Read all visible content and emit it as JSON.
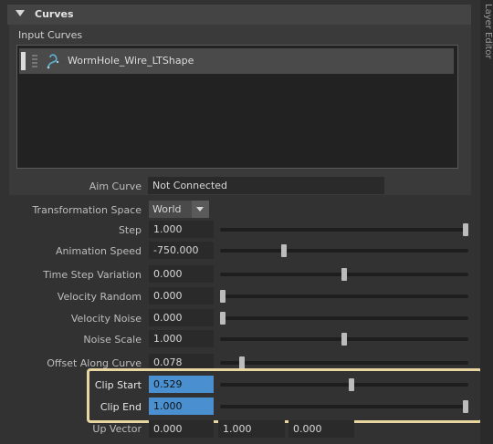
{
  "section": {
    "title": "Curves"
  },
  "input_curves": {
    "label": "Input Curves",
    "items": [
      {
        "name": "WormHole_Wire_LTShape"
      }
    ]
  },
  "aim_curve": {
    "label": "Aim Curve",
    "value": "Not Connected"
  },
  "transformation_space": {
    "label": "Transformation Space",
    "value": "World"
  },
  "params": [
    {
      "label": "Step",
      "value": "1.000",
      "slider": 1.0
    },
    {
      "label": "Animation Speed",
      "value": "-750.000",
      "slider": 0.25
    },
    {
      "label": "Time Step Variation",
      "value": "0.000",
      "slider": 0.5
    },
    {
      "label": "Velocity Random",
      "value": "0.000",
      "slider": 0.0
    },
    {
      "label": "Velocity Noise",
      "value": "0.000",
      "slider": 0.0
    },
    {
      "label": "Noise Scale",
      "value": "1.000",
      "slider": 0.5
    },
    {
      "label": "Offset Along Curve",
      "value": "0.078",
      "slider": 0.078
    },
    {
      "label": "Clip Start",
      "value": "0.529",
      "slider": 0.529
    },
    {
      "label": "Clip End",
      "value": "1.000",
      "slider": 1.0
    }
  ],
  "up_vector": {
    "label": "Up Vector",
    "x": "0.000",
    "y": "1.000",
    "z": "0.000"
  },
  "side_tab": {
    "label": "Layer Editor"
  }
}
